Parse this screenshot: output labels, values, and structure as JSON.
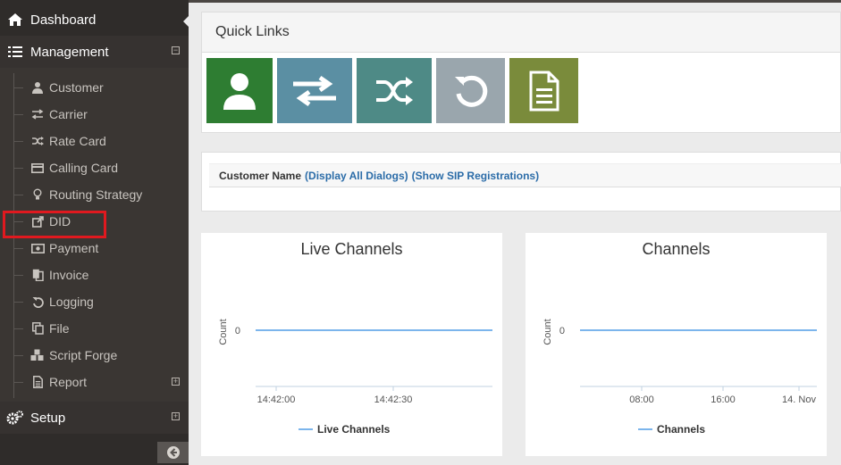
{
  "sidebar": {
    "dashboard": "Dashboard",
    "management": "Management",
    "setup": "Setup",
    "items": [
      {
        "label": "Customer",
        "icon": "user-icon"
      },
      {
        "label": "Carrier",
        "icon": "exchange-icon"
      },
      {
        "label": "Rate Card",
        "icon": "random-icon"
      },
      {
        "label": "Calling Card",
        "icon": "credit-card-icon"
      },
      {
        "label": "Routing Strategy",
        "icon": "lightbulb-icon"
      },
      {
        "label": "DID",
        "icon": "external-link-icon"
      },
      {
        "label": "Payment",
        "icon": "money-icon"
      },
      {
        "label": "Invoice",
        "icon": "files-icon"
      },
      {
        "label": "Logging",
        "icon": "undo-icon"
      },
      {
        "label": "File",
        "icon": "copy-icon"
      },
      {
        "label": "Script Forge",
        "icon": "cubes-icon"
      },
      {
        "label": "Report",
        "icon": "file-text-icon"
      }
    ]
  },
  "quick_links": {
    "title": "Quick Links",
    "buttons": [
      {
        "icon": "user-icon",
        "color": "#2e7d32"
      },
      {
        "icon": "exchange-icon",
        "color": "#5b8fa3"
      },
      {
        "icon": "random-icon",
        "color": "#4e8a86"
      },
      {
        "icon": "refresh-icon",
        "color": "#9aa6ad"
      },
      {
        "icon": "file-text-icon",
        "color": "#7a8b3b"
      }
    ]
  },
  "customer_bar": {
    "label": "Customer Name",
    "link1": "(Display All Dialogs)",
    "link2": "(Show SIP Registrations)"
  },
  "colors": {
    "series": "#7cb5ec",
    "link": "#2b6ca8",
    "highlight": "#e0191f"
  },
  "chart_data": [
    {
      "type": "line",
      "title": "Live Channels",
      "ylabel": "Count",
      "y_ticks": [
        "0"
      ],
      "x_ticks": [
        "14:42:00",
        "14:42:30"
      ],
      "series": [
        {
          "name": "Live Channels",
          "values": [
            0,
            0
          ]
        }
      ]
    },
    {
      "type": "line",
      "title": "Channels",
      "ylabel": "Count",
      "y_ticks": [
        "0"
      ],
      "x_ticks": [
        "08:00",
        "16:00",
        "14. Nov"
      ],
      "series": [
        {
          "name": "Channels",
          "values": [
            0,
            0
          ]
        }
      ]
    }
  ]
}
